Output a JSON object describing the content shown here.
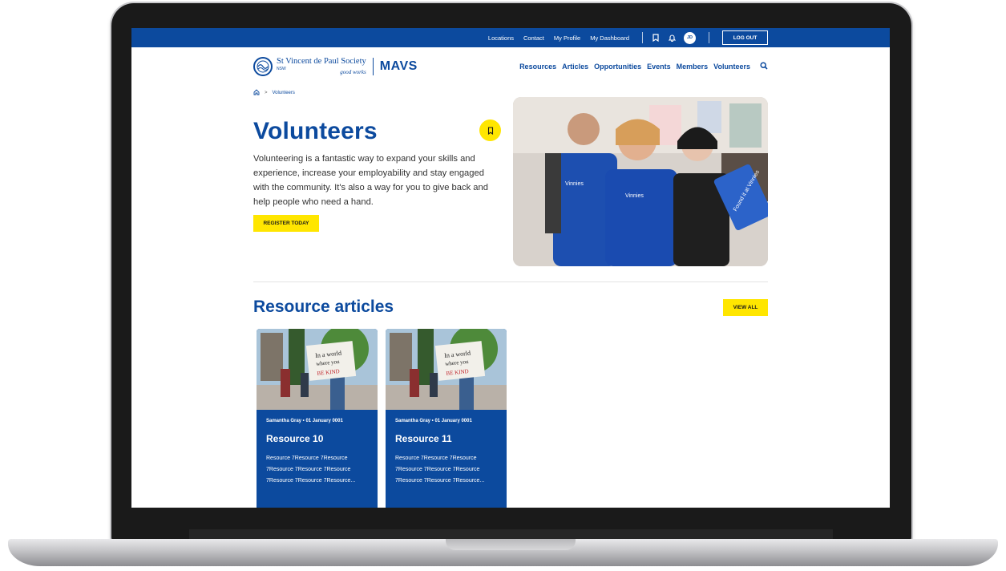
{
  "utility_bar": {
    "links": [
      "Locations",
      "Contact",
      "My Profile",
      "My Dashboard"
    ],
    "avatar_initials": "JD",
    "logout_label": "LOG OUT",
    "icons": [
      "bookmark-icon",
      "bell-icon"
    ]
  },
  "header": {
    "logo_title": "St Vincent de Paul Society",
    "logo_sub": "NSW",
    "logo_tag": "good works",
    "brand": "MAVS",
    "nav": [
      "Resources",
      "Articles",
      "Opportunities",
      "Events",
      "Members",
      "Volunteers"
    ],
    "search_icon": "search-icon"
  },
  "breadcrumb": {
    "current": "Volunteers"
  },
  "hero": {
    "title": "Volunteers",
    "description": "Volunteering is a fantastic way to expand your skills and experience, increase your employability and stay engaged with the community. It's also a way for you to give back and help people who need a hand.",
    "cta": "REGISTER TODAY"
  },
  "resources": {
    "title": "Resource articles",
    "view_all": "VIEW ALL",
    "cards": [
      {
        "meta": "Samantha Gray  •  01 January 0001",
        "title": "Resource 10",
        "excerpt": "Resource 7Resource 7Resource 7Resource 7Resource 7Resource 7Resource 7Resource 7Resource..."
      },
      {
        "meta": "Samantha Gray  •  01 January 0001",
        "title": "Resource 11",
        "excerpt": "Resource 7Resource 7Resource 7Resource 7Resource 7Resource 7Resource 7Resource 7Resource..."
      }
    ]
  },
  "colors": {
    "primary": "#0c4a9e",
    "accent": "#ffe600"
  }
}
